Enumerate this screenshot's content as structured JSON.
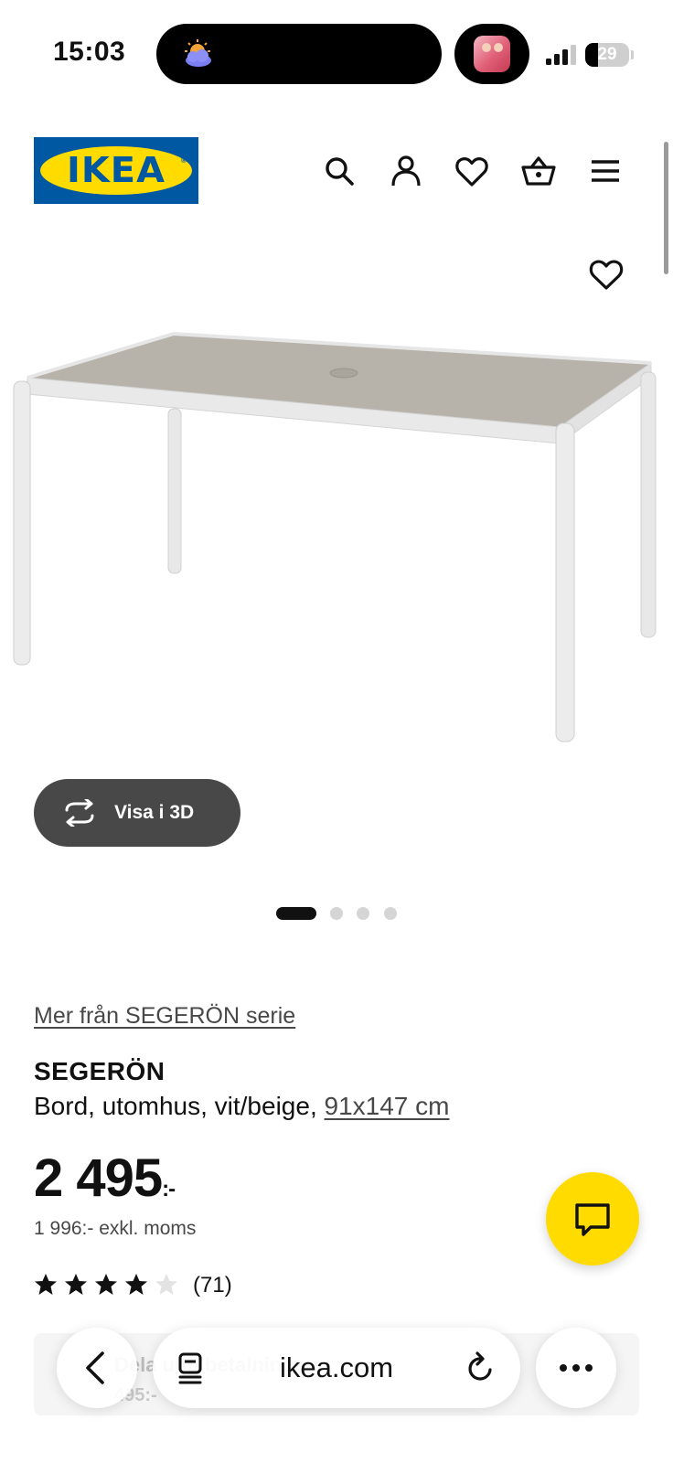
{
  "status_bar": {
    "time": "15:03",
    "battery_level": 29,
    "battery_label": "29"
  },
  "header": {
    "logo_text": "IKEA",
    "icons": [
      "search-icon",
      "account-icon",
      "favorites-icon",
      "cart-icon",
      "menu-icon"
    ]
  },
  "gallery": {
    "view_3d_label": "Visa i 3D",
    "slide_count": 4,
    "active_slide": 1
  },
  "product": {
    "series_link": "Mer från SEGERÖN serie",
    "name": "SEGERÖN",
    "description": "Bord, utomhus, vit/beige, ",
    "size_link": "91x147 cm",
    "price": "2 495",
    "price_suffix": ":-",
    "price_excl_vat": "1 996:- exkl. moms",
    "rating": 4,
    "rating_max": 5,
    "review_count": "(71)"
  },
  "behind_content": {
    "line1": "Dela upp betalningen",
    "line2": "495:-"
  },
  "browser": {
    "url": "ikea.com"
  },
  "colors": {
    "ikea_blue": "#0058a3",
    "ikea_yellow": "#ffdb00",
    "button_dark": "#484848"
  }
}
